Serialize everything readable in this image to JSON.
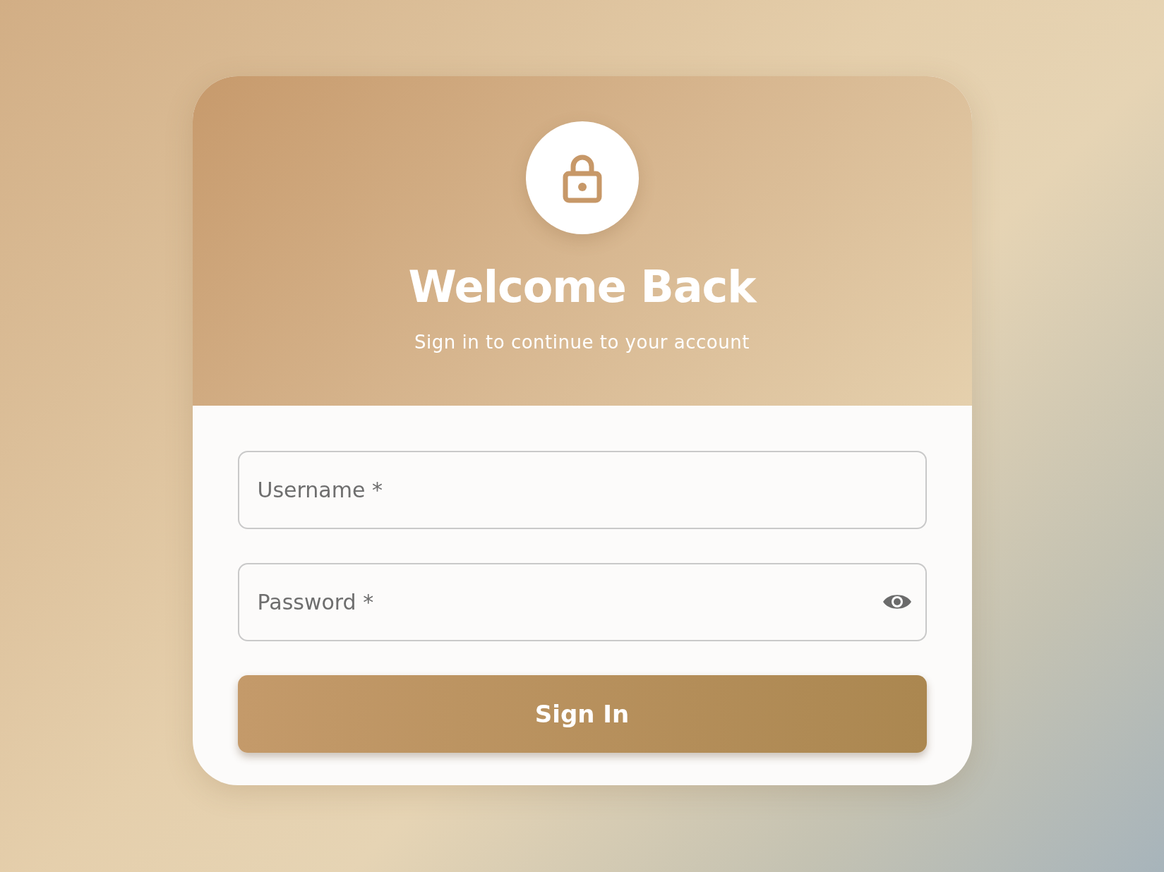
{
  "header": {
    "title": "Welcome Back",
    "subtitle": "Sign in to continue to your account"
  },
  "fields": [
    {
      "kind": "text",
      "placeholder": "Username *"
    },
    {
      "kind": "password",
      "placeholder": "Password *"
    }
  ],
  "submit": {
    "label": "Sign In"
  }
}
